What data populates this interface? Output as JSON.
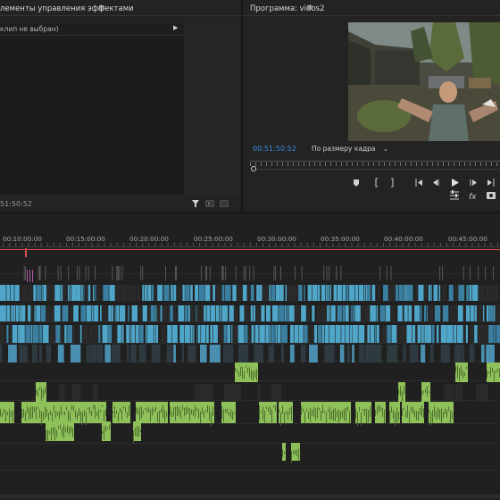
{
  "effects_panel": {
    "title": "лементы управления эффектами",
    "clip_label": "клип не выбран)",
    "timecode": "51:50:52"
  },
  "program_panel": {
    "title": "Программа: vidos2",
    "timecode": "00:51:50:52",
    "fit_label": "По размеру кадра"
  },
  "timeline": {
    "ruler": [
      "00:10:00:00",
      "00:15:00:00",
      "00:20:00:00",
      "00:25:00:00",
      "00:30:00:00",
      "00:35:00:00",
      "00:40:00:00",
      "00:45:00:00"
    ]
  },
  "colors": {
    "accent_blue": "#3c8ae0",
    "video_clip": "#4fa6c9",
    "audio_clip": "#8fc15a",
    "playhead": "#e05050"
  },
  "icons": {
    "panel_menu": "menu-icon",
    "play": "play-icon",
    "step_back": "step-back-icon",
    "step_forward": "step-forward-icon",
    "go_to_in": "go-to-in-icon",
    "go_to_out": "go-to-out-icon",
    "marker": "marker-icon",
    "mark_in": "mark-in-icon",
    "mark_out": "mark-out-icon",
    "settings": "settings-icon",
    "fx": "fx-icon",
    "camera": "export-frame-icon",
    "filter": "filter-icon"
  }
}
